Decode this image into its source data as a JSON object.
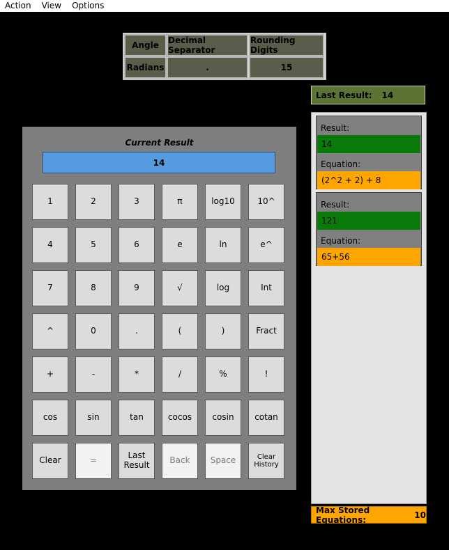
{
  "menu": [
    "Action",
    "View",
    "Options"
  ],
  "settings": {
    "headers": [
      "Angle",
      "Decimal Separator",
      "Rounding Digits"
    ],
    "values": [
      "Radians",
      ".",
      "15"
    ]
  },
  "last_result": {
    "label": "Last Result:",
    "value": "14"
  },
  "calculator": {
    "title": "Current Result",
    "display": "14",
    "keys": [
      [
        "1",
        "2",
        "3",
        "π",
        "log10",
        "10^"
      ],
      [
        "4",
        "5",
        "6",
        "e",
        "ln",
        "e^"
      ],
      [
        "7",
        "8",
        "9",
        "√",
        "log",
        "Int"
      ],
      [
        "^",
        "0",
        ".",
        "(",
        ")",
        "Fract"
      ],
      [
        "+",
        "-",
        "*",
        "/",
        "%",
        "!"
      ],
      [
        "cos",
        "sin",
        "tan",
        "cocos",
        "cosin",
        "cotan"
      ],
      [
        "Clear",
        "=",
        "Last Result",
        "Back",
        "Space",
        "Clear History"
      ]
    ]
  },
  "history": [
    {
      "result_label": "Result:",
      "result": "14",
      "equation_label": "Equation:",
      "equation": "(2^2 + 2) + 8"
    },
    {
      "result_label": "Result:",
      "result": "121",
      "equation_label": "Equation:",
      "equation": "65+56"
    }
  ],
  "max_stored": {
    "label": "Max Stored Equations:",
    "value": "10"
  },
  "colors": {
    "display": "#569be0",
    "last_result_bg": "#5b7334",
    "result_bar": "#0a7a0a",
    "equation_bar": "#ffa500",
    "max_stored_bg": "#ffa500"
  }
}
